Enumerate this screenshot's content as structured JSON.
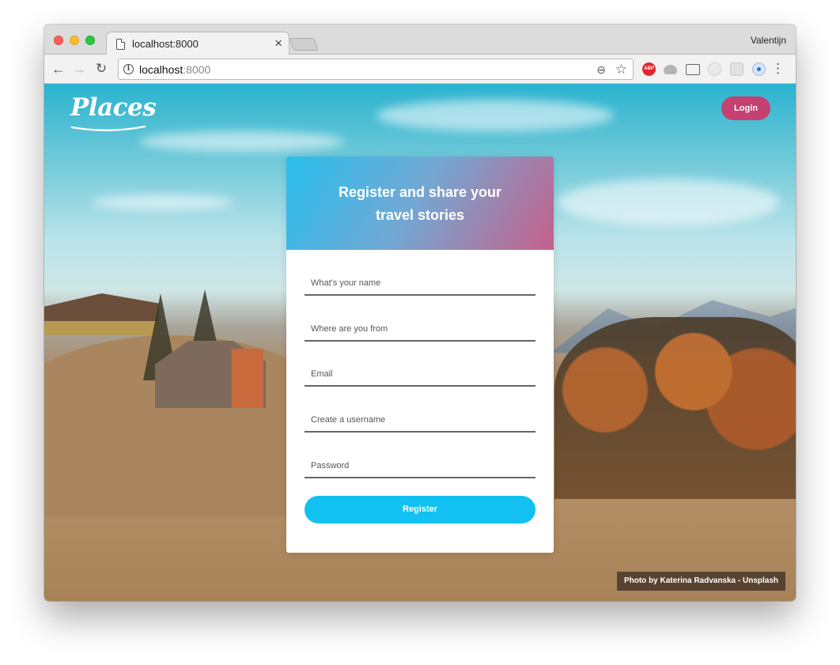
{
  "browser": {
    "tab_title": "localhost:8000",
    "tab_close": "×",
    "profile_name": "Valentijn",
    "url_host": "localhost",
    "url_port": ":8000",
    "extensions": [
      "abp-icon",
      "cloud-icon",
      "cast-icon",
      "extension-icon",
      "extension-icon",
      "extension-icon"
    ],
    "nav_icons": {
      "back": "←",
      "forward": "→",
      "reload": "↻",
      "zoom": "⊖",
      "star": "☆",
      "menu": "⋮"
    },
    "abp_label": "ABP"
  },
  "page": {
    "logo_text": "Places",
    "login_label": "Login",
    "card": {
      "title_line1": "Register and share your",
      "title_line2": "travel stories",
      "fields": [
        {
          "placeholder": "What's your name",
          "value": ""
        },
        {
          "placeholder": "Where are you from",
          "value": ""
        },
        {
          "placeholder": "Email",
          "value": ""
        },
        {
          "placeholder": "Create a username",
          "value": ""
        },
        {
          "placeholder": "Password",
          "value": ""
        }
      ],
      "register_label": "Register"
    },
    "photo_credit": "Photo by Katerina Radvanska - Unsplash"
  },
  "colors": {
    "login_button": "#c44171",
    "register_button": "#12c1f1",
    "header_gradient_start": "#28bfee",
    "header_gradient_end": "#c6608a"
  }
}
